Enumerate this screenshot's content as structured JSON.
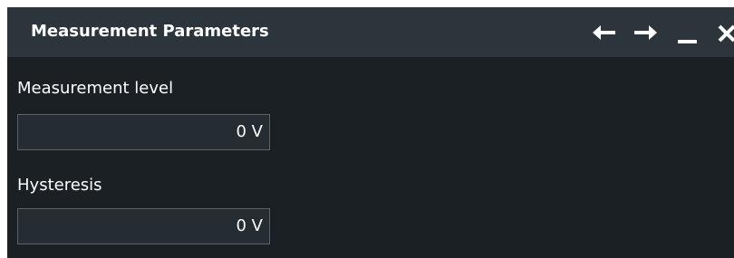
{
  "window": {
    "title": "Measurement Parameters",
    "controls": {
      "back_icon": "arrow-left-icon",
      "forward_icon": "arrow-right-icon",
      "minimize_icon": "minimize-icon",
      "close_icon": "close-icon"
    }
  },
  "fields": [
    {
      "label": "Measurement level",
      "value": "0 V"
    },
    {
      "label": "Hysteresis",
      "value": "0 V"
    }
  ],
  "colors": {
    "panel_background": "#1a2024",
    "titlebar_background": "#2c353c",
    "field_background": "#252d33",
    "field_border": "#5a6368",
    "text": "#ffffff"
  }
}
